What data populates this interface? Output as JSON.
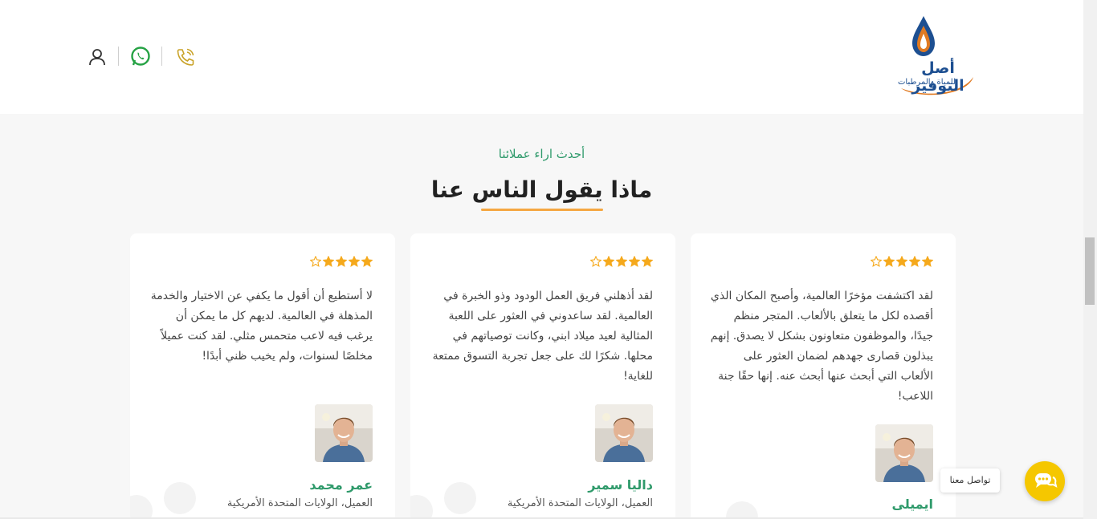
{
  "header": {
    "logo": {
      "title": "أصل التوفير",
      "subtitle": "للمياة والمرطبات"
    },
    "icons": {
      "account": "user-icon",
      "whatsapp": "whatsapp-icon",
      "phone": "phone-icon"
    },
    "colors": {
      "whatsapp": "#25a244",
      "phone": "#c9a227",
      "logo_blue": "#1d4f91",
      "logo_orange": "#e07a22"
    }
  },
  "section": {
    "eyebrow": "أحدث اراء عملائنا",
    "title": "ماذا يقول الناس عنا",
    "accent": "#f5a742"
  },
  "testimonials": [
    {
      "rating": 4,
      "text": "لقد اكتشفت مؤخرًا العالمية، وأصبح المكان الذي أقصده لكل ما يتعلق بالألعاب. المتجر منظم جيدًا، والموظفون متعاونون بشكل لا يصدق. إنهم يبذلون قصارى جهدهم لضمان العثور على الألعاب التي أبحث عنها أبحث عنه. إنها حقًا جنة اللاعب!",
      "name": "ايميلى",
      "role": ""
    },
    {
      "rating": 4,
      "text": "لقد أذهلني فريق العمل الودود وذو الخبرة في العالمية. لقد ساعدوني في العثور على اللعبة المثالية لعيد ميلاد ابني، وكانت توصياتهم في محلها. شكرًا لك على جعل تجربة التسوق ممتعة للغاية!",
      "name": "داليا سمير",
      "role": "العميل، الولايات المتحدة الأمريكية"
    },
    {
      "rating": 4,
      "text": "لا أستطيع أن أقول ما يكفي عن الاختيار والخدمة المذهلة في العالمية. لديهم كل ما يمكن أن يرغب فيه لاعب متحمس مثلي. لقد كنت عميلاً مخلصًا لسنوات، ولم يخيب ظني أبدًا!",
      "name": "عمر محمد",
      "role": "العميل، الولايات المتحدة الأمريكية"
    }
  ],
  "chat": {
    "label": "تواصل معنا",
    "icon": "chat-bubbles-icon",
    "color": "#f5c700"
  }
}
